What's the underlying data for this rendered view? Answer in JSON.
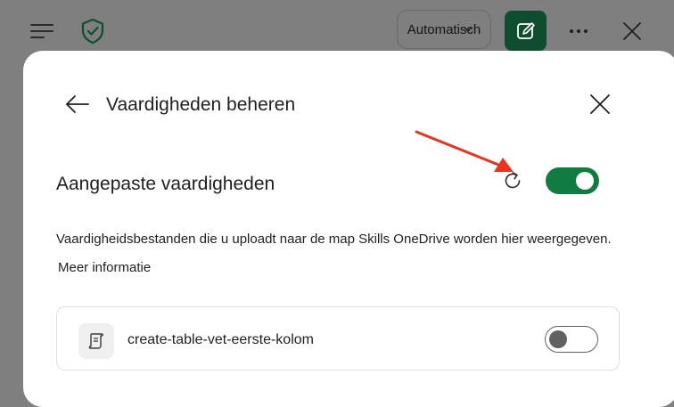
{
  "toolbar": {
    "mode_select_value": "Automatisch",
    "icons": [
      "menu-icon",
      "shield-check-icon",
      "chevron-down-icon",
      "compose-icon",
      "more-icon",
      "close-icon"
    ]
  },
  "dialog": {
    "title": "Vaardigheden beheren",
    "section_label": "Aangepaste vaardigheden",
    "section_toggle_on": true,
    "description": "Vaardigheidsbestanden die u uploadt naar de map Skills OneDrive worden hier weergegeven.",
    "more_info_link": "Meer informatie",
    "skills": [
      {
        "name": "create-table-vet-eerste-kolom",
        "enabled": false
      }
    ]
  },
  "colors": {
    "accent_green": "#107c41",
    "dark_green": "#0f4d2f",
    "annotation_red": "#e8351d",
    "overlay": "#7f7f7f"
  }
}
